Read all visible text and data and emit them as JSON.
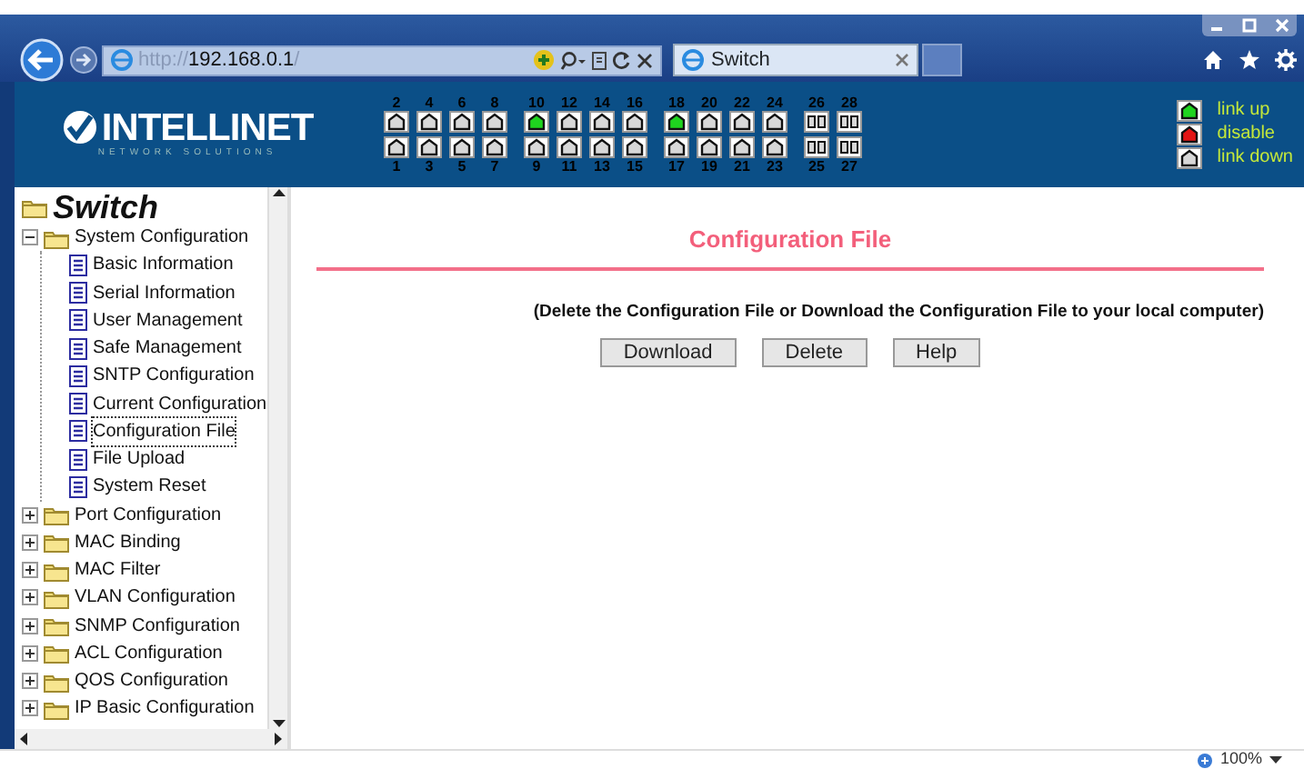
{
  "browser": {
    "address": {
      "scheme": "http://",
      "host": "192.168.0.1",
      "path": "/"
    },
    "tab": {
      "title": "Switch"
    },
    "zoom": "100%"
  },
  "header": {
    "logo": "INTELLINET",
    "tagline": "NETWORK SOLUTIONS",
    "port_groups": [
      {
        "kind": "rj45",
        "columns": [
          {
            "top": {
              "label": "2",
              "link_up": false
            },
            "bottom": {
              "label": "1",
              "link_up": false
            }
          },
          {
            "top": {
              "label": "4",
              "link_up": false
            },
            "bottom": {
              "label": "3",
              "link_up": false
            }
          },
          {
            "top": {
              "label": "6",
              "link_up": false
            },
            "bottom": {
              "label": "5",
              "link_up": false
            }
          },
          {
            "top": {
              "label": "8",
              "link_up": false
            },
            "bottom": {
              "label": "7",
              "link_up": false
            }
          }
        ]
      },
      {
        "kind": "rj45",
        "columns": [
          {
            "top": {
              "label": "10",
              "link_up": true
            },
            "bottom": {
              "label": "9",
              "link_up": false
            }
          },
          {
            "top": {
              "label": "12",
              "link_up": false
            },
            "bottom": {
              "label": "11",
              "link_up": false
            }
          },
          {
            "top": {
              "label": "14",
              "link_up": false
            },
            "bottom": {
              "label": "13",
              "link_up": false
            }
          },
          {
            "top": {
              "label": "16",
              "link_up": false
            },
            "bottom": {
              "label": "15",
              "link_up": false
            }
          }
        ]
      },
      {
        "kind": "rj45",
        "columns": [
          {
            "top": {
              "label": "18",
              "link_up": true
            },
            "bottom": {
              "label": "17",
              "link_up": false
            }
          },
          {
            "top": {
              "label": "20",
              "link_up": false
            },
            "bottom": {
              "label": "19",
              "link_up": false
            }
          },
          {
            "top": {
              "label": "22",
              "link_up": false
            },
            "bottom": {
              "label": "21",
              "link_up": false
            }
          },
          {
            "top": {
              "label": "24",
              "link_up": false
            },
            "bottom": {
              "label": "23",
              "link_up": false
            }
          }
        ]
      },
      {
        "kind": "sfp",
        "columns": [
          {
            "top": {
              "label": "26",
              "link_up": false
            },
            "bottom": {
              "label": "25",
              "link_up": false
            }
          },
          {
            "top": {
              "label": "28",
              "link_up": false
            },
            "bottom": {
              "label": "27",
              "link_up": false
            }
          }
        ]
      }
    ],
    "legend": [
      {
        "label": "link up",
        "color": "#1fd41f"
      },
      {
        "label": "disable",
        "color": "#e21414"
      },
      {
        "label": "link down",
        "color": "#d8d8d8"
      }
    ]
  },
  "sidebar": {
    "root": "Switch",
    "items": [
      {
        "label": "System Configuration",
        "expanded": true,
        "children": [
          {
            "label": "Basic Information",
            "selected": false
          },
          {
            "label": "Serial Information",
            "selected": false
          },
          {
            "label": "User Management",
            "selected": false
          },
          {
            "label": "Safe Management",
            "selected": false
          },
          {
            "label": "SNTP Configuration",
            "selected": false
          },
          {
            "label": "Current Configuration",
            "selected": false
          },
          {
            "label": "Configuration File",
            "selected": true
          },
          {
            "label": "File Upload",
            "selected": false
          },
          {
            "label": "System Reset",
            "selected": false
          }
        ]
      },
      {
        "label": "Port Configuration",
        "expanded": false
      },
      {
        "label": "MAC Binding",
        "expanded": false
      },
      {
        "label": "MAC Filter",
        "expanded": false
      },
      {
        "label": "VLAN Configuration",
        "expanded": false
      },
      {
        "label": "SNMP Configuration",
        "expanded": false
      },
      {
        "label": "ACL Configuration",
        "expanded": false
      },
      {
        "label": "QOS Configuration",
        "expanded": false
      },
      {
        "label": "IP Basic Configuration",
        "expanded": false
      }
    ]
  },
  "main": {
    "title": "Configuration File",
    "description": "(Delete the Configuration File or Download the Configuration File to your local computer)",
    "buttons": [
      "Download",
      "Delete",
      "Help"
    ]
  }
}
